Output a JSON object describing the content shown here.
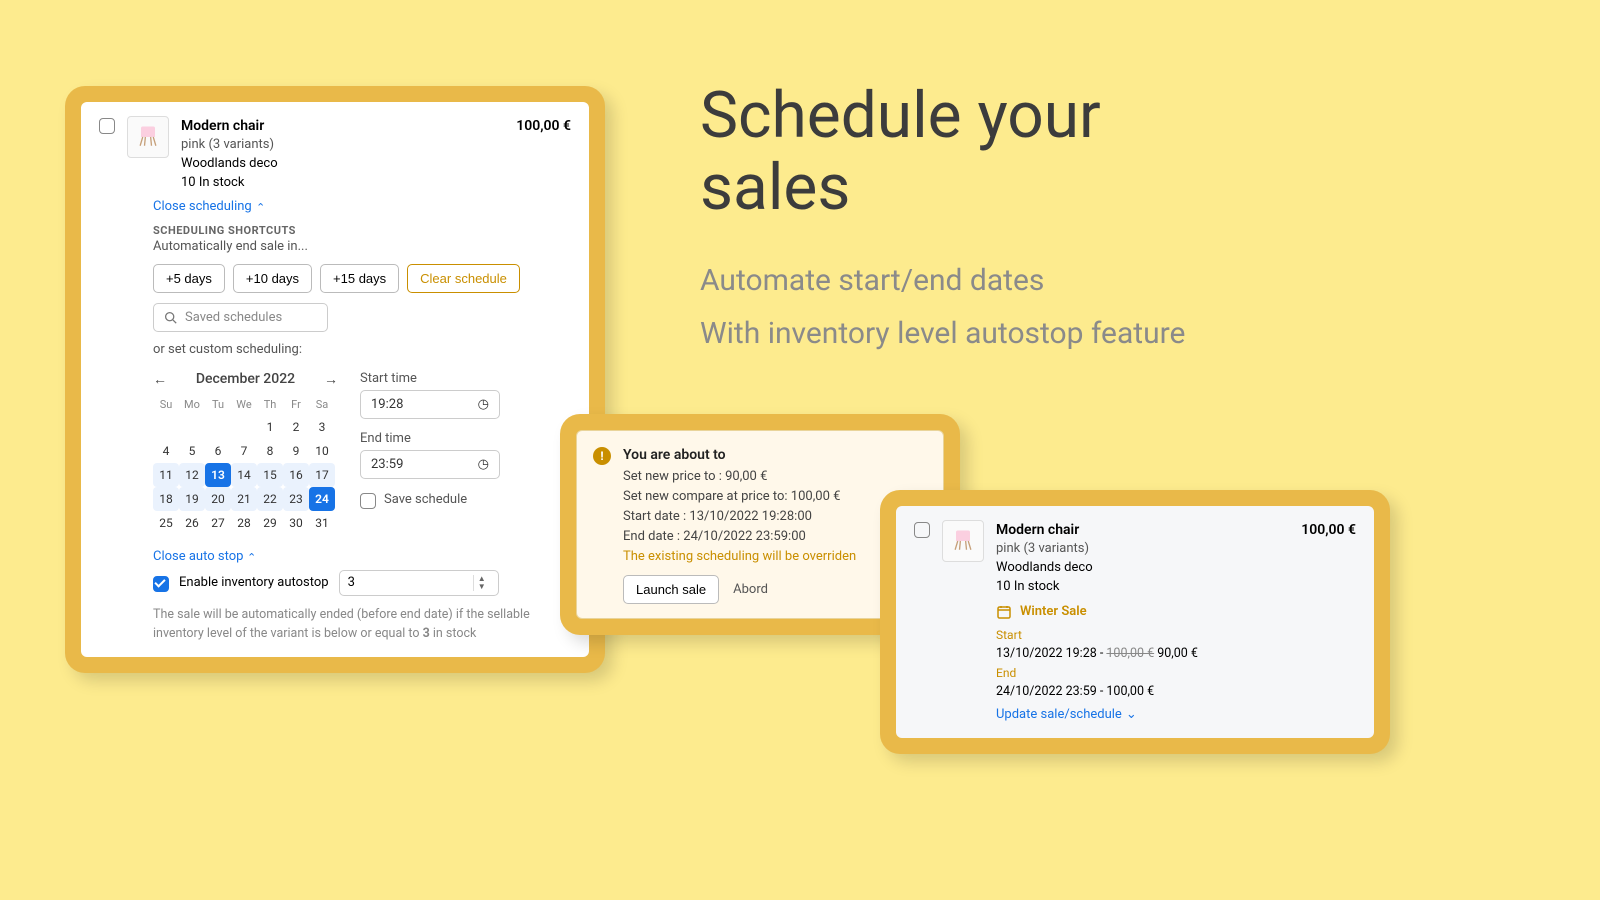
{
  "hero": {
    "title_l1": "Schedule your",
    "title_l2": "sales",
    "sub_l1": "Automate start/end dates",
    "sub_l2": "With inventory level autostop feature"
  },
  "panel1": {
    "product": {
      "name": "Modern chair",
      "price": "100,00 €",
      "variant_color": "pink",
      "variant_link": "(3 variants)",
      "vendor": "Woodlands deco",
      "stock": "10 In stock"
    },
    "close_scheduling": "Close scheduling",
    "shortcuts_label": "SCHEDULING SHORTCUTS",
    "shortcuts_sub": "Automatically end sale in...",
    "btn_5": "+5 days",
    "btn_10": "+10 days",
    "btn_15": "+15 days",
    "btn_clear": "Clear schedule",
    "search_placeholder": "Saved schedules",
    "or_text": "or set custom scheduling:",
    "month": "December 2022",
    "dows": [
      "Su",
      "Mo",
      "Tu",
      "We",
      "Th",
      "Fr",
      "Sa"
    ],
    "days": [
      "",
      "",
      "",
      "",
      "1",
      "2",
      "3",
      "4",
      "5",
      "6",
      "7",
      "8",
      "9",
      "10",
      "11",
      "12",
      "13",
      "14",
      "15",
      "16",
      "17",
      "18",
      "19",
      "20",
      "21",
      "22",
      "23",
      "24",
      "25",
      "26",
      "27",
      "28",
      "29",
      "30",
      "31"
    ],
    "selected_days": [
      13,
      24
    ],
    "range_days": [
      11,
      12,
      14,
      15,
      16,
      17,
      18,
      19,
      20,
      21,
      22,
      23
    ],
    "start_label": "Start time",
    "start_value": "19:28",
    "end_label": "End time",
    "end_value": "23:59",
    "save_schedule": "Save schedule",
    "close_autostop": "Close auto stop",
    "enable_autostop": "Enable inventory autostop",
    "threshold": "3",
    "help_text_a": "The sale will be automatically ended (before end date) if the sellable inventory level of the variant is below or equal to ",
    "help_text_b": "3",
    "help_text_c": " in stock"
  },
  "panel2": {
    "title": "You are about to",
    "l1": "Set new price to : 90,00 €",
    "l2": "Set new compare at price to: 100,00 €",
    "l3": "Start date : 13/10/2022 19:28:00",
    "l4": "End date : 24/10/2022 23:59:00",
    "override": "The existing scheduling will be overriden",
    "launch": "Launch sale",
    "abort": "Abord"
  },
  "panel3": {
    "product": {
      "name": "Modern chair",
      "price": "100,00 €",
      "variant_color": "pink",
      "variant_link": "(3 variants)",
      "vendor": "Woodlands deco",
      "stock": "10 In stock"
    },
    "sale_name": "Winter Sale",
    "start_label": "Start",
    "start_time": "13/10/2022 19:28 - ",
    "start_old": "100,00 €",
    "start_new": " 90,00 €",
    "end_label": "End",
    "end_line": "24/10/2022 23:59 - 100,00 €",
    "update_link": "Update sale/schedule"
  }
}
